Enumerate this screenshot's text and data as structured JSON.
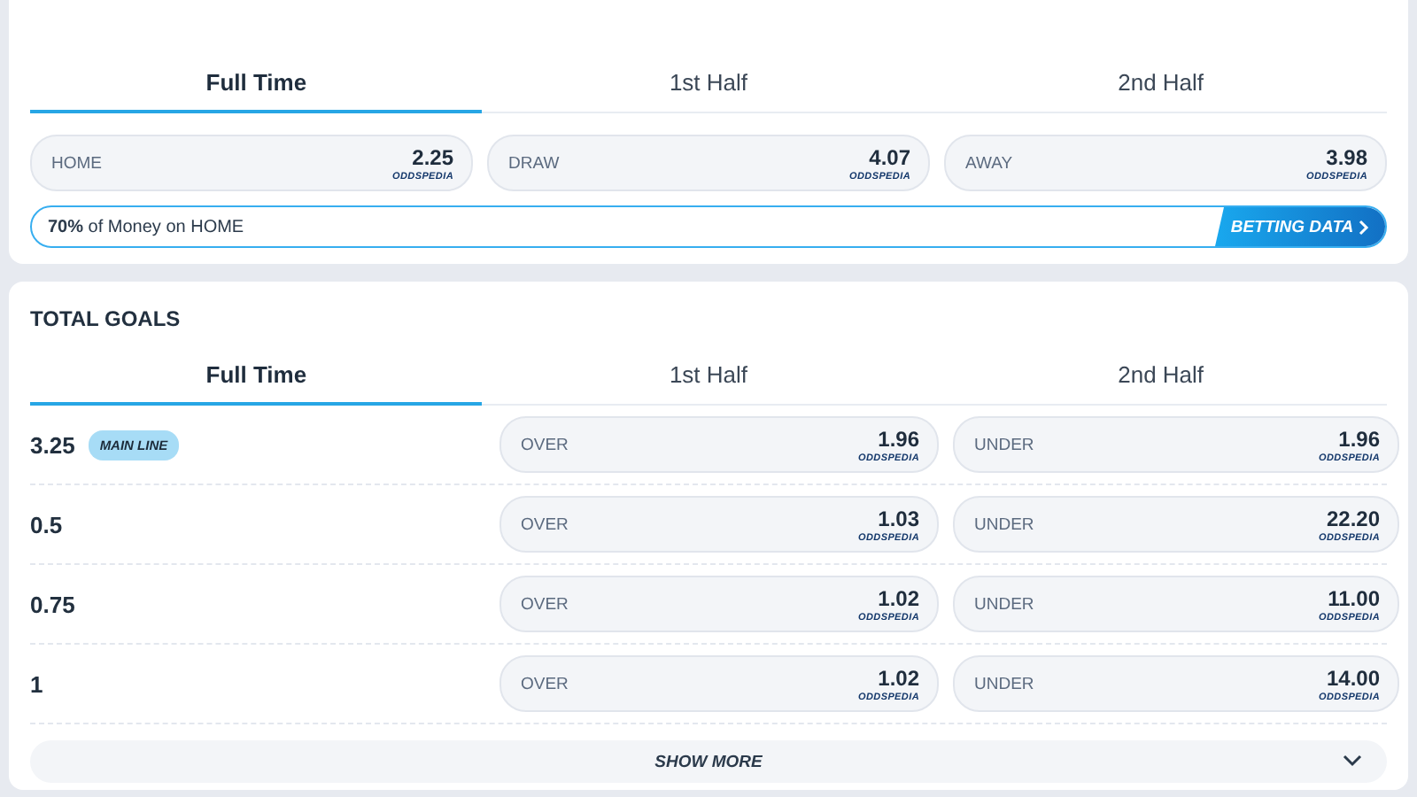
{
  "match_result": {
    "tabs": [
      {
        "label": "Full Time",
        "selected": true
      },
      {
        "label": "1st Half",
        "selected": false
      },
      {
        "label": "2nd Half",
        "selected": false
      }
    ],
    "odds": [
      {
        "label": "HOME",
        "value": "2.25",
        "source": "ODDSPEDIA"
      },
      {
        "label": "DRAW",
        "value": "4.07",
        "source": "ODDSPEDIA"
      },
      {
        "label": "AWAY",
        "value": "3.98",
        "source": "ODDSPEDIA"
      }
    ],
    "money_bar": {
      "text": "**70%** of Money on HOME",
      "button": "BETTING DATA"
    }
  },
  "total_goals": {
    "title": "TOTAL GOALS",
    "tabs": [
      {
        "label": "Full Time",
        "selected": true
      },
      {
        "label": "1st Half",
        "selected": false
      },
      {
        "label": "2nd Half",
        "selected": false
      }
    ],
    "rows": [
      {
        "line": "3.25",
        "badge": "MAIN LINE",
        "odds": [
          {
            "label": "OVER",
            "value": "1.96",
            "source": "ODDSPEDIA"
          },
          {
            "label": "UNDER",
            "value": "1.96",
            "source": "ODDSPEDIA"
          }
        ]
      },
      {
        "line": "0.5",
        "odds": [
          {
            "label": "OVER",
            "value": "1.03",
            "source": "ODDSPEDIA"
          },
          {
            "label": "UNDER",
            "value": "22.20",
            "source": "ODDSPEDIA"
          }
        ]
      },
      {
        "line": "0.75",
        "odds": [
          {
            "label": "OVER",
            "value": "1.02",
            "source": "ODDSPEDIA"
          },
          {
            "label": "UNDER",
            "value": "11.00",
            "source": "ODDSPEDIA"
          }
        ]
      },
      {
        "line": "1",
        "odds": [
          {
            "label": "OVER",
            "value": "1.02",
            "source": "ODDSPEDIA"
          },
          {
            "label": "UNDER",
            "value": "14.00",
            "source": "ODDSPEDIA"
          }
        ]
      }
    ],
    "show_more": "SHOW MORE"
  }
}
